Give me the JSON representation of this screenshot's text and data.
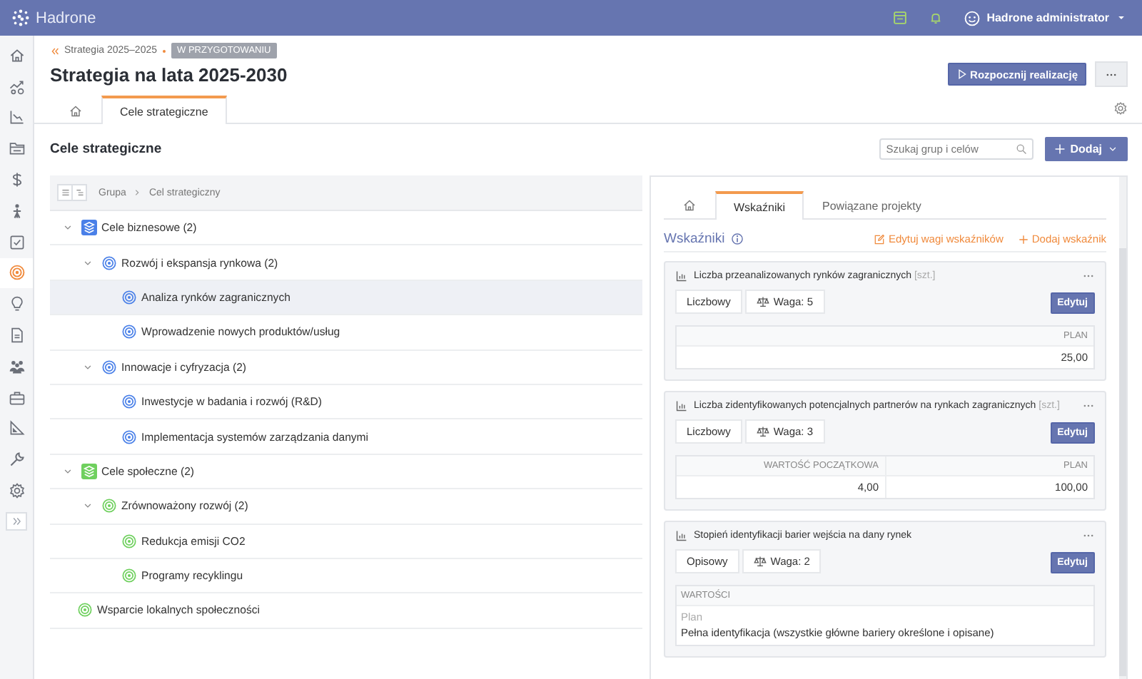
{
  "topbar": {
    "logo": "Hadrone",
    "user": "Hadrone administrator"
  },
  "sidebar": {
    "items": [
      {
        "selected": false
      },
      {
        "selected": false
      },
      {
        "selected": false
      },
      {
        "selected": false
      },
      {
        "selected": false
      },
      {
        "selected": false
      },
      {
        "selected": false
      },
      {
        "selected": true
      },
      {
        "selected": false
      },
      {
        "selected": false
      },
      {
        "selected": false
      },
      {
        "selected": false
      },
      {
        "selected": false
      },
      {
        "selected": false
      },
      {
        "selected": false
      }
    ]
  },
  "header": {
    "breadcrumb": "Strategia 2025–2025",
    "status": "W PRZYGOTOWANIU",
    "title": "Strategia na lata 2025-2030",
    "primary_button": "Rozpocznij realizację",
    "tabs": [
      {
        "kind": "home",
        "selected": false
      },
      {
        "kind": "text",
        "label": "Cele strategiczne",
        "selected": true
      }
    ]
  },
  "section": {
    "title": "Cele strategiczne",
    "search": {
      "placeholder": "Szukaj grup i celów"
    },
    "add_button": "Dodaj"
  },
  "tree": {
    "breadcrumb": [
      "Grupa",
      "Cel strategiczny"
    ],
    "items": [
      {
        "kind": "group",
        "label": "Cele biznesowe (2)",
        "color": "#4a80e8",
        "expanded": true,
        "selected": false,
        "children": [
          {
            "kind": "goal",
            "label": "Rozwój i ekspansja rynkowa (2)",
            "color": "#4a80e8",
            "expanded": true,
            "selected": false,
            "children": [
              {
                "kind": "goal",
                "label": "Analiza rynków zagranicznych",
                "color": "#4a80e8",
                "selected": true
              },
              {
                "kind": "goal",
                "label": "Wprowadzenie nowych produktów/usług",
                "color": "#4a80e8",
                "selected": false
              }
            ]
          },
          {
            "kind": "goal",
            "label": "Innowacje i cyfryzacja (2)",
            "color": "#4a80e8",
            "expanded": true,
            "selected": false,
            "children": [
              {
                "kind": "goal",
                "label": "Inwestycje w badania i rozwój (R&D)",
                "color": "#4a80e8",
                "selected": false
              },
              {
                "kind": "goal",
                "label": "Implementacja systemów zarządzania danymi",
                "color": "#4a80e8",
                "selected": false
              }
            ]
          }
        ]
      },
      {
        "kind": "group",
        "label": "Cele społeczne (2)",
        "color": "#6fd05e",
        "expanded": true,
        "selected": false,
        "children": [
          {
            "kind": "goal",
            "label": "Zrównoważony rozwój (2)",
            "color": "#6fd05e",
            "expanded": true,
            "selected": false,
            "children": [
              {
                "kind": "goal",
                "label": "Redukcja emisji CO2",
                "color": "#6fd05e",
                "selected": false
              },
              {
                "kind": "goal",
                "label": "Programy recyklingu",
                "color": "#6fd05e",
                "selected": false
              }
            ]
          },
          {
            "kind": "goal",
            "label": "Wsparcie lokalnych społeczności",
            "color": "#6fd05e",
            "selected": false
          }
        ]
      }
    ]
  },
  "detail": {
    "tabs": [
      {
        "kind": "home",
        "selected": false
      },
      {
        "kind": "text",
        "label": "Wskaźniki",
        "selected": true
      },
      {
        "kind": "text",
        "label": "Powiązane projekty",
        "selected": false
      }
    ],
    "heading": "Wskaźniki",
    "edit_weights": "Edytuj wagi wskaźników",
    "add_indicator": "Dodaj wskaźnik",
    "indicators": [
      {
        "kind": "table",
        "title": "Liczba przeanalizowanych rynków zagranicznych",
        "unit": "[szt.]",
        "type": "Liczbowy",
        "weight": "Waga: 5",
        "edit": "Edytuj",
        "columns": [
          "PLAN"
        ],
        "values": [
          "25,00"
        ]
      },
      {
        "kind": "table",
        "title": "Liczba zidentyfikowanych potencjalnych partnerów na rynkach zagranicznych",
        "unit": "[szt.]",
        "type": "Liczbowy",
        "weight": "Waga: 3",
        "edit": "Edytuj",
        "columns": [
          "WARTOŚĆ POCZĄTKOWA",
          "PLAN"
        ],
        "values": [
          "4,00",
          "100,00"
        ]
      },
      {
        "kind": "text",
        "title": "Stopień identyfikacji barier wejścia na dany rynek",
        "type": "Opisowy",
        "weight": "Waga: 2",
        "edit": "Edytuj",
        "values_header": "WARTOŚCI",
        "value_label": "Plan",
        "value": "Pełna identyfikacja (wszystkie główne bariery określone i opisane)"
      }
    ]
  }
}
